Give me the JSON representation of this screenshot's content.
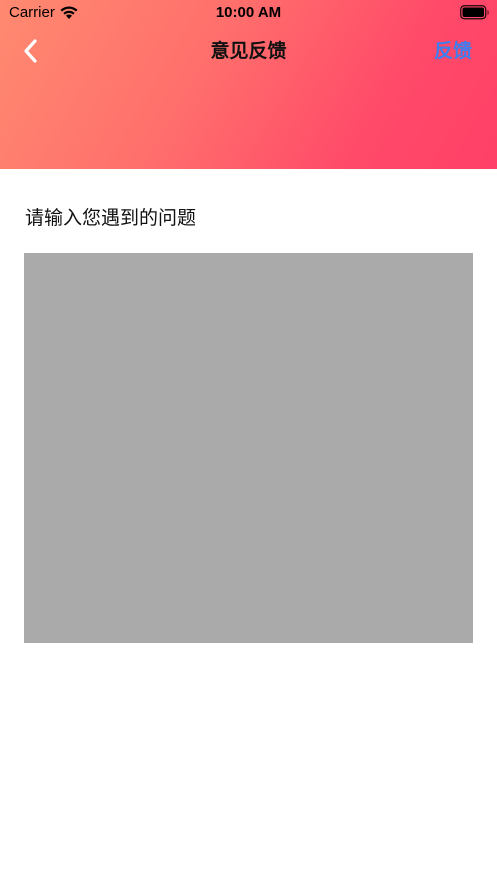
{
  "status_bar": {
    "carrier": "Carrier",
    "time": "10:00 AM",
    "wifi_icon": "wifi-icon",
    "battery_icon": "battery-icon"
  },
  "nav": {
    "back_icon": "chevron-left-icon",
    "title": "意见反馈",
    "action_label": "反馈"
  },
  "form": {
    "prompt": "请输入您遇到的问题",
    "input_value": "",
    "input_placeholder": ""
  },
  "colors": {
    "header_gradient_start": "#ff8a70",
    "header_gradient_end": "#ff4068",
    "action_text": "#3d7ef0",
    "input_background": "#aaaaaa"
  }
}
